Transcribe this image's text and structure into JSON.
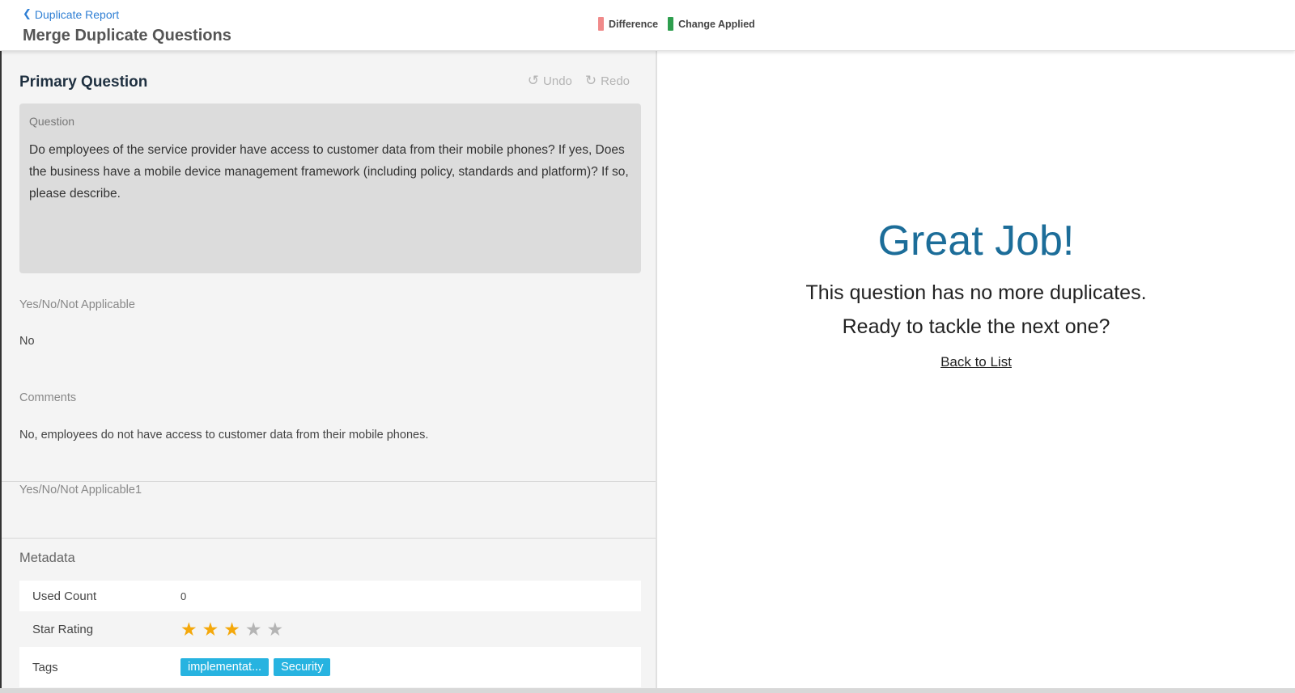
{
  "header": {
    "back_label": "Duplicate Report",
    "title": "Merge Duplicate Questions",
    "legend": {
      "difference_label": "Difference",
      "difference_color": "#f08a8a",
      "change_label": "Change Applied",
      "change_color": "#2e9e4e"
    }
  },
  "primary": {
    "title": "Primary Question",
    "undo_label": "Undo",
    "redo_label": "Redo",
    "question_label": "Question",
    "question_text": "Do employees of the service provider have access to customer data from their mobile phones? If yes, Does the business have a mobile device management framework (including policy, standards and platform)? If so, please describe.",
    "fields": [
      {
        "label": "Yes/No/Not Applicable",
        "value": "No"
      },
      {
        "label": "Comments",
        "value": "No, employees do not have access to customer data from their mobile phones."
      },
      {
        "label": "Yes/No/Not Applicable1",
        "value": ""
      }
    ]
  },
  "metadata": {
    "title": "Metadata",
    "used_count_label": "Used Count",
    "used_count_value": "0",
    "star_rating_label": "Star Rating",
    "star_rating": 3,
    "star_max": 5,
    "tags_label": "Tags",
    "tags": [
      "implementat...",
      "Security"
    ]
  },
  "completion": {
    "headline": "Great Job!",
    "line1": "This question has no more duplicates.",
    "line2": "Ready to tackle the next one?",
    "link": "Back to List"
  }
}
